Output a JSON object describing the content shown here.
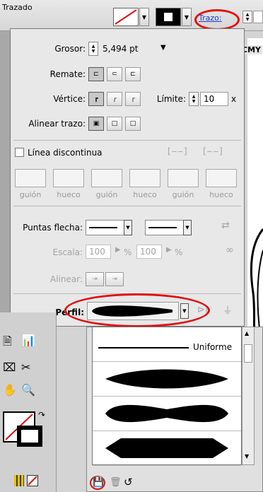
{
  "control_bar": {
    "title": "Trazado",
    "trazo_label": "Trazo:",
    "cmyk_label": "CMY"
  },
  "stroke_panel": {
    "weight_label": "Grosor:",
    "weight_value": "5,494 pt",
    "cap_label": "Remate:",
    "corner_label": "Vértice:",
    "limit_label": "Límite:",
    "limit_value": "10",
    "limit_suffix": "x",
    "align_label": "Alinear trazo:",
    "dashed_label": "Línea discontinua",
    "dash_labels": [
      "guión",
      "hueco",
      "guión",
      "hueco",
      "guión",
      "hueco"
    ],
    "arrowheads_label": "Puntas flecha:",
    "scale_label": "Escala:",
    "scale_start": "100",
    "scale_end": "100",
    "percent": "%",
    "align_arrows_label": "Alinear:",
    "profile_label": "Perfil:"
  },
  "profile_menu": {
    "items": [
      "Uniforme",
      "",
      "",
      "",
      ""
    ]
  },
  "colors": {
    "highlight_ring": "#e01010",
    "link_blue": "#1a3ae0",
    "panel_bg": "#e8e8e8"
  }
}
